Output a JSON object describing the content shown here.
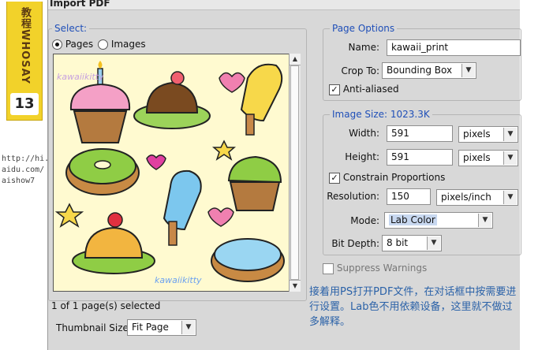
{
  "side": {
    "tag_text": "教程WHOSAY",
    "tag_number": "13",
    "url_lines": [
      "http://hi.b",
      "aidu.com/",
      "aishow7"
    ]
  },
  "dialog": {
    "title": "Import PDF",
    "select": {
      "legend": "Select:",
      "radio_pages": "Pages",
      "radio_images": "Images",
      "selected": "Pages",
      "status": "1 of 1 page(s) selected",
      "thumbnail_label": "Thumbnail Size:",
      "thumbnail_value": "Fit Page"
    },
    "page_options": {
      "legend": "Page Options",
      "name_label": "Name:",
      "name_value": "kawaii_print",
      "crop_label": "Crop To:",
      "crop_value": "Bounding Box",
      "anti_aliased_label": "Anti-aliased",
      "anti_aliased_checked": true
    },
    "image_size": {
      "legend": "Image Size: 1023.3K",
      "width_label": "Width:",
      "width_value": "591",
      "width_unit": "pixels",
      "height_label": "Height:",
      "height_value": "591",
      "height_unit": "pixels",
      "constrain_label": "Constrain Proportions",
      "constrain_checked": true,
      "resolution_label": "Resolution:",
      "resolution_value": "150",
      "resolution_unit": "pixels/inch",
      "mode_label": "Mode:",
      "mode_value": "Lab Color",
      "depth_label": "Bit Depth:",
      "depth_value": "8 bit"
    },
    "suppress_label": "Suppress Warnings",
    "suppress_checked": false
  },
  "caption": {
    "text": "接着用PS打开PDF文件，在对话框中按需要进行设置。Lab色不用依赖设备，这里就不做过多解释。"
  },
  "preview_sticker_text": "kawaiikitty",
  "colors": {
    "legend_blue": "#1f4fb8",
    "preview_bg": "#fffad0",
    "tag_yellow": "#f2d22a",
    "caption_blue": "#2b62a8"
  }
}
